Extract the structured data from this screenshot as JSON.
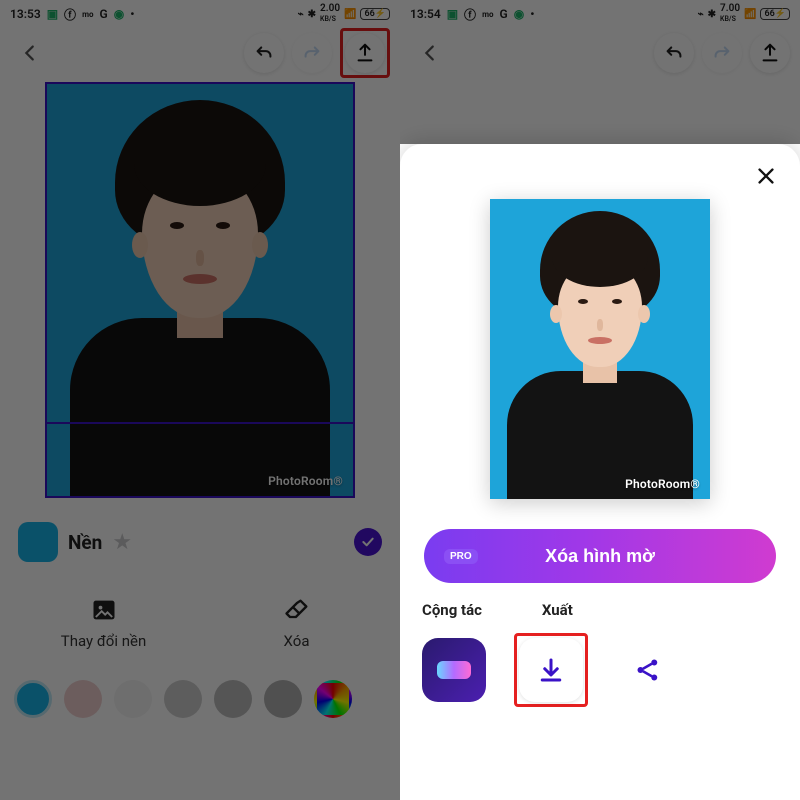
{
  "status": {
    "time_left": "13:53",
    "time_right": "13:54",
    "net_left": {
      "rate": "2.00",
      "unit": "KB/S"
    },
    "net_right": {
      "rate": "7.00",
      "unit": "KB/S"
    },
    "battery": "66"
  },
  "editor": {
    "watermark": "PhotoRoom®",
    "background_section": "Nền",
    "tools": {
      "change_bg": "Thay đổi nền",
      "erase": "Xóa"
    },
    "palette": [
      {
        "name": "cyan",
        "color": "#18b4e8",
        "selected": true
      },
      {
        "name": "blush",
        "color": "#f0cfcf",
        "selected": false
      },
      {
        "name": "white",
        "color": "#f3f3f3",
        "selected": false
      },
      {
        "name": "gray1",
        "color": "#cfcfcf",
        "selected": false
      },
      {
        "name": "gray2",
        "color": "#bdbdbd",
        "selected": false
      },
      {
        "name": "gray3",
        "color": "#b1b1b1",
        "selected": false
      },
      {
        "name": "rainbow",
        "color": "conic",
        "selected": false
      }
    ]
  },
  "export_sheet": {
    "cta_pro_badge": "PRO",
    "cta_label": "Xóa hình mờ",
    "section_collab": "Cộng tác",
    "section_export": "Xuất"
  }
}
